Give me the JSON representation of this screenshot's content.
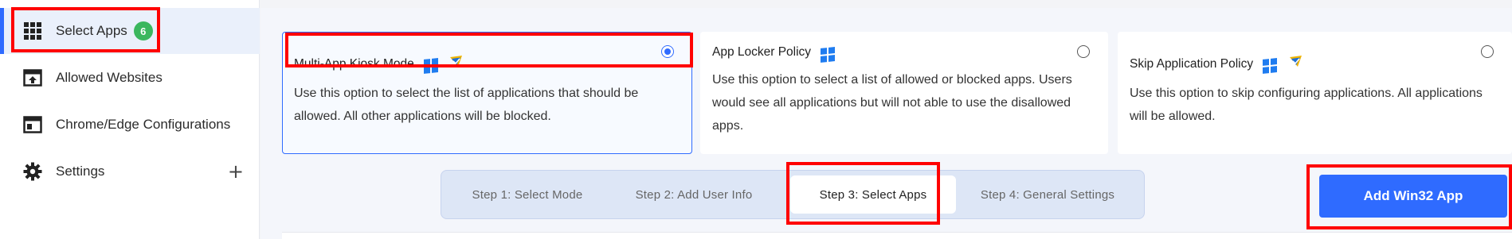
{
  "sidebar": {
    "items": [
      {
        "label": "Select Apps",
        "icon": "grid-icon",
        "badge": "6",
        "active": true
      },
      {
        "label": "Allowed Websites",
        "icon": "web-upload-icon"
      },
      {
        "label": "Chrome/Edge Configurations",
        "icon": "browser-window-icon"
      },
      {
        "label": "Settings",
        "icon": "gear-icon",
        "expand": "+"
      }
    ]
  },
  "modes": [
    {
      "title": "Multi-App Kiosk Mode",
      "desc": "Use this option to select the list of applications that should be allowed. All other applications will be blocked.",
      "selected": true,
      "icons": [
        "windows-icon",
        "shield-icon"
      ]
    },
    {
      "title": "App Locker Policy",
      "desc": "Use this option to select a list of allowed or blocked apps. Users would see all applications but will not able to use the disallowed apps.",
      "selected": false,
      "icons": [
        "windows-icon"
      ]
    },
    {
      "title": "Skip Application Policy",
      "desc": "Use this option to skip configuring applications. All applications will be allowed.",
      "selected": false,
      "icons": [
        "windows-icon",
        "shield-icon"
      ]
    }
  ],
  "steps": [
    {
      "label": "Step 1: Select Mode"
    },
    {
      "label": "Step 2: Add User Info"
    },
    {
      "label": "Step 3: Select Apps",
      "active": true
    },
    {
      "label": "Step 4: General Settings"
    }
  ],
  "actions": {
    "add_win32": "Add Win32 App"
  },
  "colors": {
    "accent": "#2f6bff",
    "badge": "#3bb75e",
    "highlight": "#ff0000"
  }
}
